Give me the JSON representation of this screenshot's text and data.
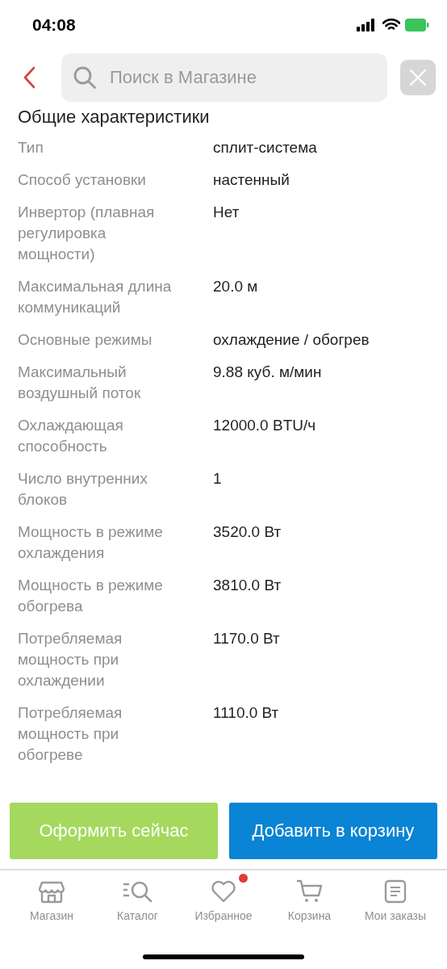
{
  "status_bar": {
    "time": "04:08"
  },
  "search": {
    "placeholder": "Поиск в Магазине"
  },
  "section_title": "Общие характеристики",
  "specs": [
    {
      "label": "Тип",
      "value": "сплит-система"
    },
    {
      "label": "Способ установки",
      "value": "настенный"
    },
    {
      "label": "Инвертор (плавная регулировка мощности)",
      "value": "Нет"
    },
    {
      "label": "Максимальная длина коммуникаций",
      "value": "20.0 м"
    },
    {
      "label": "Основные режимы",
      "value": "охлаждение / обогрев"
    },
    {
      "label": "Максимальный воздушный поток",
      "value": "9.88 куб. м/мин"
    },
    {
      "label": "Охлаждающая способность",
      "value": "12000.0 BTU/ч"
    },
    {
      "label": "Число внутренних блоков",
      "value": "1"
    },
    {
      "label": "Мощность в режиме охлаждения",
      "value": "3520.0 Вт"
    },
    {
      "label": "Мощность в режиме обогрева",
      "value": "3810.0 Вт"
    },
    {
      "label": "Потребляемая мощность при охлаждении",
      "value": "1170.0 Вт"
    },
    {
      "label": "Потребляемая мощность при обогреве",
      "value": "1110.0 Вт"
    }
  ],
  "actions": [
    {
      "label": "Оформить сейчас",
      "kind": "checkout"
    },
    {
      "label": "Добавить в корзину",
      "kind": "cart"
    }
  ],
  "nav": [
    {
      "label": "Магазин",
      "kind": "store",
      "dot": false
    },
    {
      "label": "Каталог",
      "kind": "catalog",
      "dot": false
    },
    {
      "label": "Избранное",
      "kind": "favorites",
      "dot": true
    },
    {
      "label": "Корзина",
      "kind": "cart",
      "dot": false
    },
    {
      "label": "Мои заказы",
      "kind": "orders",
      "dot": false
    }
  ]
}
